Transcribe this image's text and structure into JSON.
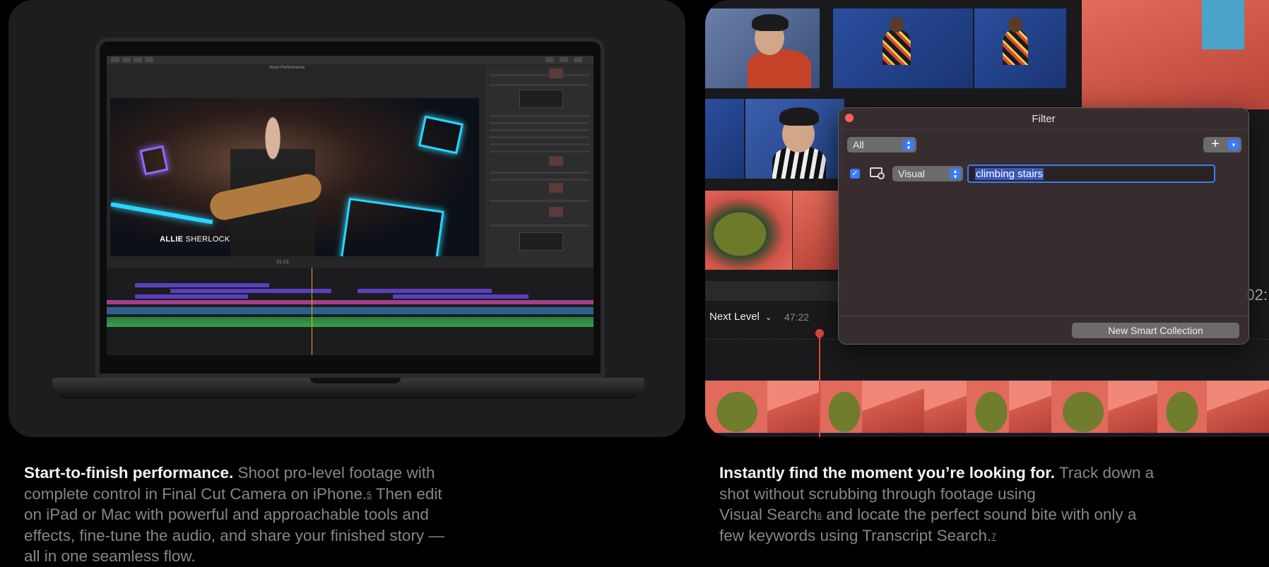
{
  "left_panel": {
    "lower_third": {
      "first": "ALLIE",
      "last": "SHERLOCK"
    },
    "viewer_title": "Neon Performance",
    "viewer_timecode": "31:13"
  },
  "right_panel": {
    "project": {
      "name": "Next Level",
      "duration": "47:22",
      "timecode_partial": "02:"
    },
    "filter_dialog": {
      "title": "Filter",
      "match_select": "All",
      "add_rule_label": "+",
      "rule": {
        "type": "Visual",
        "query": "climbing stairs",
        "enabled": true
      },
      "footer_button": "New Smart Collection"
    }
  },
  "captions": {
    "left": {
      "headline": "Start-to-finish performance.",
      "line1": " Shoot pro-level footage with",
      "line2": "complete control in Final Cut Camera on iPhone.",
      "footnote": "5",
      "line2b": " Then edit",
      "line3": "on iPad or Mac with powerful and approachable tools and",
      "line4": "effects, fine-tune the audio, and share your finished story —",
      "line5": "all in one seamless flow."
    },
    "right": {
      "headline": "Instantly find the moment you’re looking for.",
      "line1": " Track down a",
      "line2": "shot without scrubbing through footage using",
      "line3a": "Visual Search",
      "footnote1": "6",
      "line3b": " and locate the perfect sound bite with only a",
      "line4": "few keywords using Transcript Search.",
      "footnote2": "7"
    }
  }
}
